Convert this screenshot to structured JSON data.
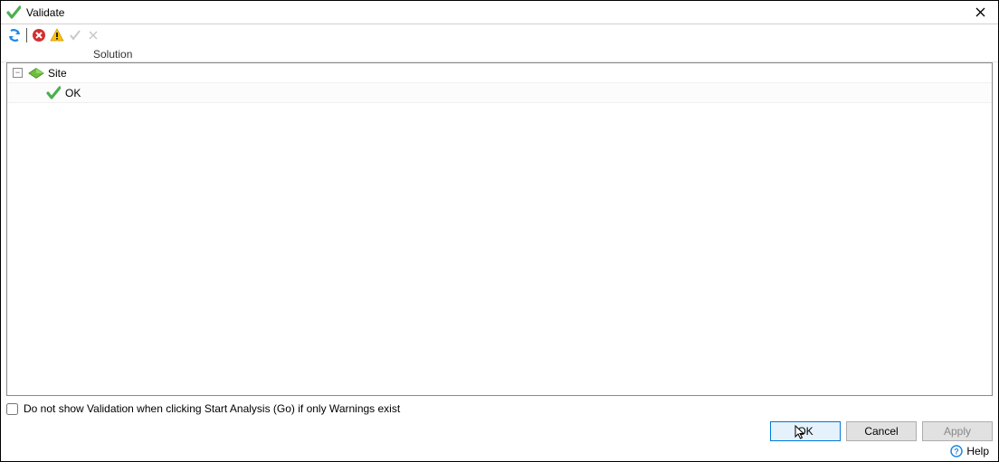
{
  "title": "Validate",
  "header": {
    "solution_label": "Solution"
  },
  "tree": {
    "root_label": "Site",
    "child_label": "OK"
  },
  "checkbox": {
    "label": "Do not show Validation when clicking Start Analysis (Go) if only Warnings exist",
    "checked": false
  },
  "buttons": {
    "ok": "OK",
    "cancel": "Cancel",
    "apply": "Apply"
  },
  "help": {
    "label": "Help"
  }
}
